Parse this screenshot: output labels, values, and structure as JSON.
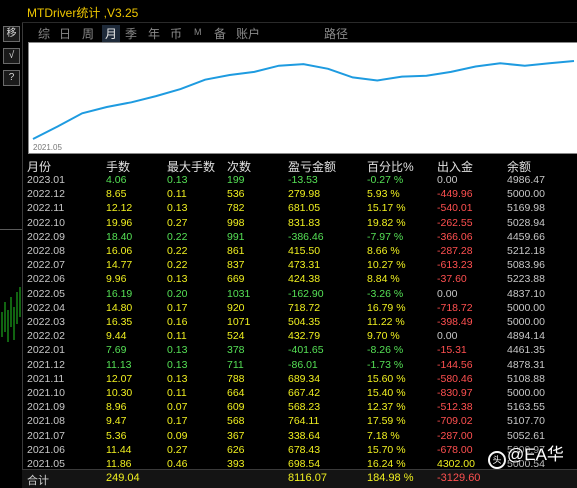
{
  "window": {
    "title": "MTDriver统计 ,V3.25"
  },
  "tools": {
    "btn1": "移",
    "btn2": "√",
    "btn3": "?"
  },
  "tabs": [
    {
      "label": "综",
      "active": false
    },
    {
      "label": "日",
      "active": false
    },
    {
      "label": "周",
      "active": false
    },
    {
      "label": "月",
      "active": true
    },
    {
      "label": "季",
      "active": false
    },
    {
      "label": "年",
      "active": false
    },
    {
      "label": "币",
      "active": false
    },
    {
      "label": "M",
      "active": false
    },
    {
      "label": "备",
      "active": false
    },
    {
      "label": "账户",
      "active": false
    },
    {
      "label": "路径",
      "active": false
    }
  ],
  "equity_chart": {
    "start_label": "2021.05",
    "line_color": "#1e9be0",
    "points": [
      0,
      0.16,
      0.33,
      0.41,
      0.47,
      0.55,
      0.64,
      0.76,
      0.82,
      0.86,
      0.94,
      0.96,
      0.9,
      0.79,
      0.75,
      0.8,
      0.81,
      0.86,
      0.93,
      0.97,
      0.94,
      0.97,
      1.0
    ]
  },
  "table": {
    "headers": [
      "月份",
      "手数",
      "最大手数",
      "次数",
      "盈亏金额",
      "百分比%",
      "出入金",
      "余额"
    ],
    "rows": [
      [
        "2023.01",
        "4.06",
        "0.13",
        "199",
        "-13.53",
        "-0.27 %",
        "0.00",
        "4986.47"
      ],
      [
        "2022.12",
        "8.65",
        "0.11",
        "536",
        "279.98",
        "5.93 %",
        "-449.96",
        "5000.00"
      ],
      [
        "2022.11",
        "12.12",
        "0.13",
        "782",
        "681.05",
        "15.17 %",
        "-540.01",
        "5169.98"
      ],
      [
        "2022.10",
        "19.96",
        "0.27",
        "998",
        "831.83",
        "19.82 %",
        "-262.55",
        "5028.94"
      ],
      [
        "2022.09",
        "18.40",
        "0.22",
        "991",
        "-386.46",
        "-7.97 %",
        "-366.06",
        "4459.66"
      ],
      [
        "2022.08",
        "16.06",
        "0.22",
        "861",
        "415.50",
        "8.66 %",
        "-287.28",
        "5212.18"
      ],
      [
        "2022.07",
        "14.77",
        "0.22",
        "837",
        "473.31",
        "10.27 %",
        "-613.23",
        "5083.96"
      ],
      [
        "2022.06",
        "9.96",
        "0.13",
        "669",
        "424.38",
        "8.84 %",
        "-37.60",
        "5223.88"
      ],
      [
        "2022.05",
        "16.19",
        "0.20",
        "1031",
        "-162.90",
        "-3.26 %",
        "0.00",
        "4837.10"
      ],
      [
        "2022.04",
        "14.80",
        "0.17",
        "920",
        "718.72",
        "16.79 %",
        "-718.72",
        "5000.00"
      ],
      [
        "2022.03",
        "16.35",
        "0.16",
        "1071",
        "504.35",
        "11.22 %",
        "-398.49",
        "5000.00"
      ],
      [
        "2022.02",
        "9.44",
        "0.11",
        "524",
        "432.79",
        "9.70 %",
        "0.00",
        "4894.14"
      ],
      [
        "2022.01",
        "7.69",
        "0.13",
        "378",
        "-401.65",
        "-8.26 %",
        "-15.31",
        "4461.35"
      ],
      [
        "2021.12",
        "11.13",
        "0.13",
        "711",
        "-86.01",
        "-1.73 %",
        "-144.56",
        "4878.31"
      ],
      [
        "2021.11",
        "12.07",
        "0.13",
        "788",
        "689.34",
        "15.60 %",
        "-580.46",
        "5108.88"
      ],
      [
        "2021.10",
        "10.30",
        "0.11",
        "664",
        "667.42",
        "15.40 %",
        "-830.97",
        "5000.00"
      ],
      [
        "2021.09",
        "8.96",
        "0.07",
        "609",
        "568.23",
        "12.37 %",
        "-512.38",
        "5163.55"
      ],
      [
        "2021.08",
        "9.47",
        "0.17",
        "568",
        "764.11",
        "17.59 %",
        "-709.02",
        "5107.70"
      ],
      [
        "2021.07",
        "5.36",
        "0.09",
        "367",
        "338.64",
        "7.18 %",
        "-287.00",
        "5052.61"
      ],
      [
        "2021.06",
        "11.44",
        "0.27",
        "626",
        "678.43",
        "15.70 %",
        "-678.00",
        "5000.97"
      ],
      [
        "2021.05",
        "11.86",
        "0.46",
        "393",
        "698.54",
        "16.24 %",
        "4302.00",
        "5000.54"
      ]
    ],
    "total": {
      "label": "合计",
      "lots": "249.04",
      "profit": "8116.07",
      "pct": "184.98 %",
      "flow": "-3129.60"
    }
  },
  "watermark": {
    "symbol": "头",
    "text": "@EA华"
  },
  "colors": {
    "accent_yellow": "#f0f020",
    "loss_green": "#55e055",
    "withdraw_red": "#ff5050",
    "title_gold": "#f0c800"
  }
}
